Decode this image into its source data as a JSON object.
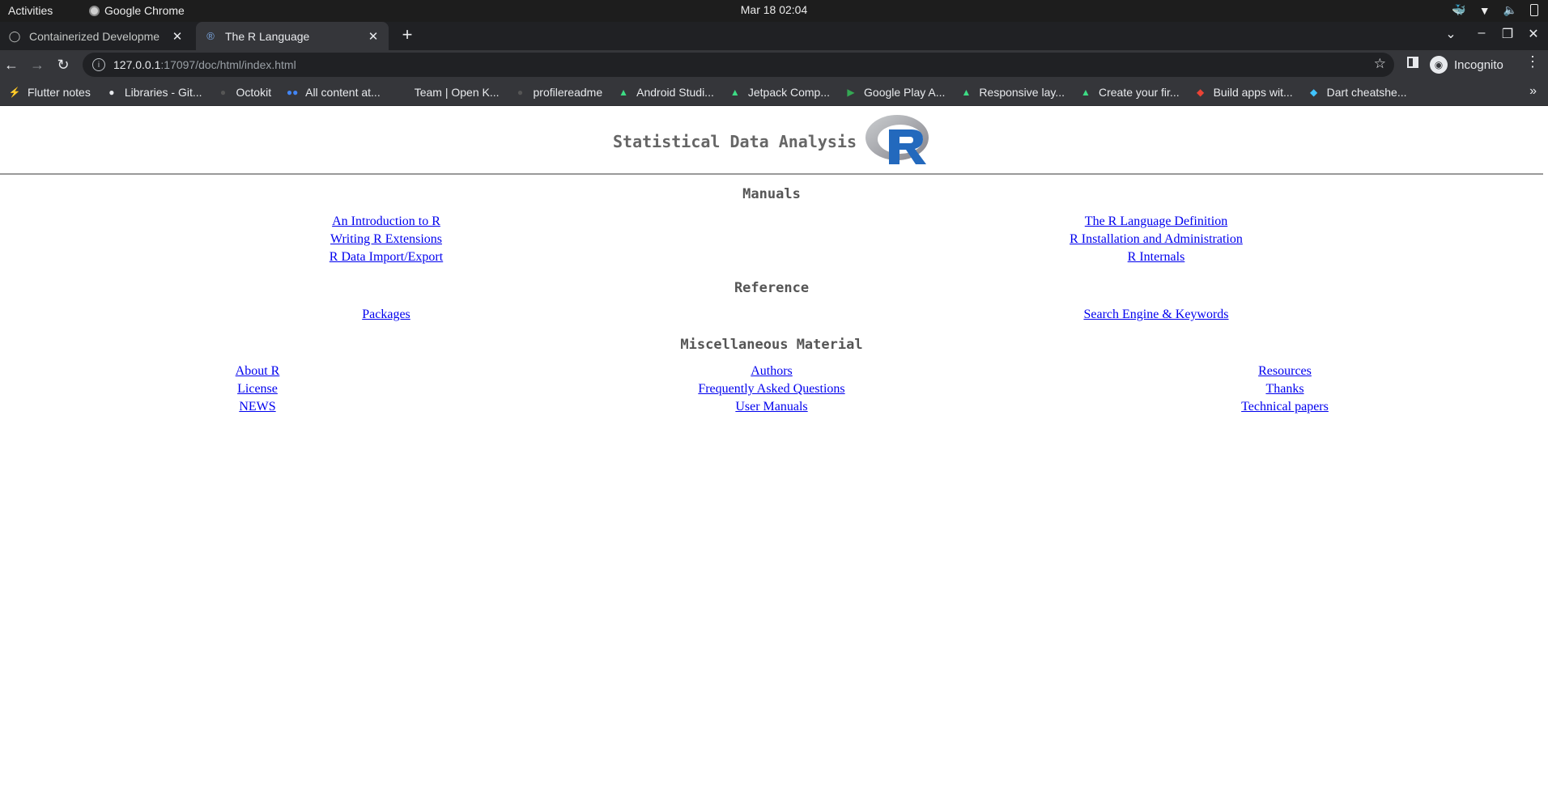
{
  "system_bar": {
    "activities": "Activities",
    "app_name": "Google Chrome",
    "datetime": "Mar 18  02:04"
  },
  "tabs": [
    {
      "title": "Containerized Developme",
      "icon": "github-icon",
      "active": false
    },
    {
      "title": "The R Language",
      "icon": "r-logo-icon",
      "active": true
    }
  ],
  "address_bar": {
    "host": "127.0.0.1",
    "path": ":17097/doc/html/index.html"
  },
  "profile": {
    "label": "Incognito"
  },
  "bookmarks": [
    {
      "label": "Flutter notes",
      "icon": "flutter-icon"
    },
    {
      "label": "Libraries - Git...",
      "icon": "github-icon"
    },
    {
      "label": "Octokit",
      "icon": "github-icon"
    },
    {
      "label": "All content at...",
      "icon": "dots-icon"
    },
    {
      "label": "Team | Open K...",
      "icon": "blank-icon"
    },
    {
      "label": "profilereadme",
      "icon": "github-icon"
    },
    {
      "label": "Android Studi...",
      "icon": "android-icon"
    },
    {
      "label": "Jetpack Comp...",
      "icon": "android-icon"
    },
    {
      "label": "Google Play A...",
      "icon": "play-icon"
    },
    {
      "label": "Responsive lay...",
      "icon": "android-icon"
    },
    {
      "label": "Create your fir...",
      "icon": "android-icon"
    },
    {
      "label": "Build apps wit...",
      "icon": "google-icon"
    },
    {
      "label": "Dart cheatshe...",
      "icon": "dart-icon"
    }
  ],
  "page": {
    "title": "Statistical Data Analysis",
    "manuals": {
      "heading": "Manuals",
      "left": [
        "An Introduction to R",
        "Writing R Extensions",
        "R Data Import/Export"
      ],
      "right": [
        "The R Language Definition",
        "R Installation and Administration",
        "R Internals"
      ]
    },
    "reference": {
      "heading": "Reference",
      "left": [
        "Packages"
      ],
      "right": [
        "Search Engine & Keywords"
      ]
    },
    "misc": {
      "heading": "Miscellaneous Material",
      "col1": [
        "About R",
        "License",
        "NEWS"
      ],
      "col2": [
        "Authors",
        "Frequently Asked Questions",
        "User Manuals"
      ],
      "col3": [
        "Resources",
        "Thanks",
        "Technical papers"
      ]
    }
  },
  "colors": {
    "link": "#0000ee",
    "r_logo_ring": "#b8bcc4",
    "r_logo_letter": "#2369bd"
  }
}
